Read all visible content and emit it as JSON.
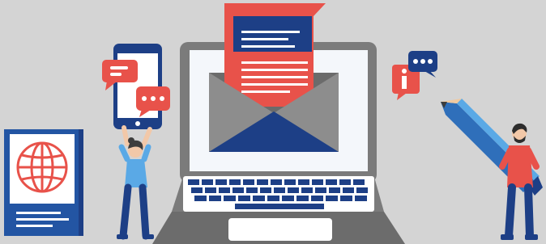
{
  "colors": {
    "background": "#d4d4d4",
    "navy": "#1d3f86",
    "blue": "#2f6fba",
    "light_blue": "#5aa9e6",
    "red": "#e8524a",
    "laptop_gray": "#7b7b7b",
    "screen_white": "#f4f7fb",
    "envelope_gray": "#808080"
  },
  "icons": [
    "passport-icon",
    "globe-icon",
    "smartphone-icon",
    "chat-bubble-icon",
    "laptop-icon",
    "envelope-icon",
    "letter-icon",
    "info-chat-icon",
    "pencil-icon",
    "woman-figure",
    "man-figure"
  ]
}
